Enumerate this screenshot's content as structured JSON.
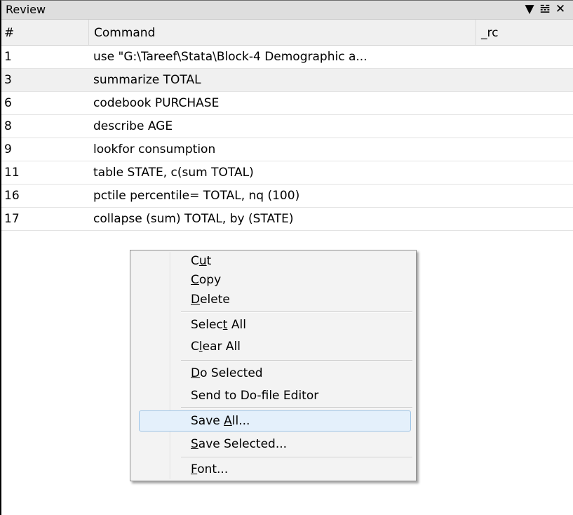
{
  "panel": {
    "title": "Review",
    "icons": [
      "filter-icon",
      "pin-icon",
      "close-icon"
    ]
  },
  "table": {
    "columns": [
      "#",
      "Command",
      "_rc"
    ],
    "rows": [
      {
        "num": "1",
        "cmd": "use \"G:\\Tareef\\Stata\\Block-4  Demographic a..."
      },
      {
        "num": "3",
        "cmd": "summarize TOTAL"
      },
      {
        "num": "6",
        "cmd": "codebook PURCHASE"
      },
      {
        "num": "8",
        "cmd": "describe AGE"
      },
      {
        "num": "9",
        "cmd": "lookfor consumption"
      },
      {
        "num": "11",
        "cmd": "table STATE, c(sum TOTAL)"
      },
      {
        "num": "16",
        "cmd": "pctile percentile= TOTAL, nq (100)"
      },
      {
        "num": "17",
        "cmd": "collapse (sum) TOTAL, by (STATE)"
      }
    ]
  },
  "context_menu": {
    "items": [
      {
        "label": "Cut",
        "access_key": "u"
      },
      {
        "label": "Copy",
        "access_key": "C"
      },
      {
        "label": "Delete",
        "access_key": "D"
      },
      {
        "label": "Select All",
        "access_key": "t"
      },
      {
        "label": "Clear All",
        "access_key": "l"
      },
      {
        "label": "Do Selected",
        "access_key": "D"
      },
      {
        "label": "Send to Do-file Editor",
        "access_key": ""
      },
      {
        "label": "Save All...",
        "access_key": "A"
      },
      {
        "label": "Save Selected...",
        "access_key": "S"
      },
      {
        "label": "Font...",
        "access_key": "F"
      }
    ],
    "highlighted": "Save All..."
  }
}
